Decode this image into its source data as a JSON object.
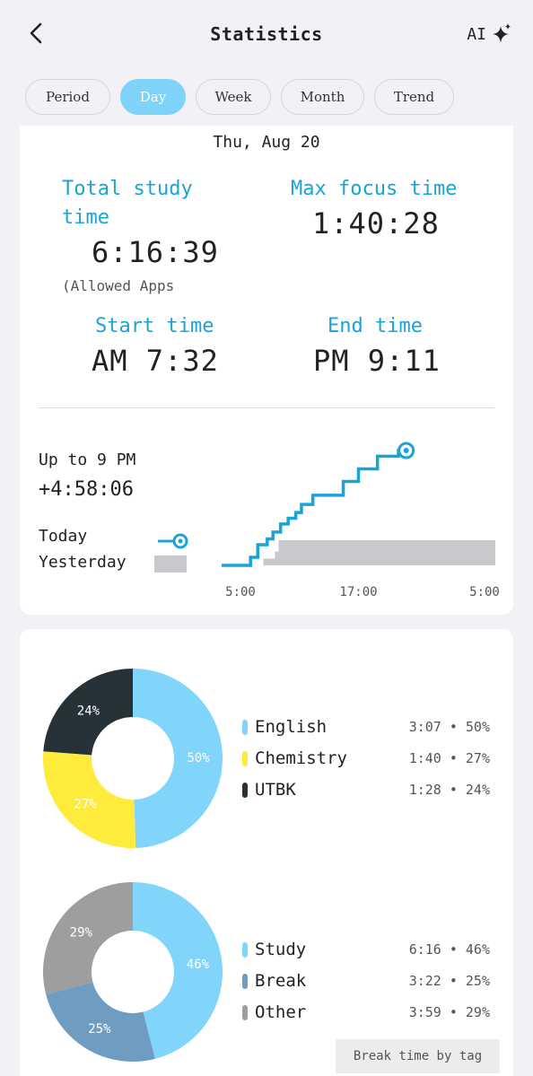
{
  "header": {
    "title": "Statistics",
    "ai_label": "AI"
  },
  "tabs": [
    {
      "label": "Period"
    },
    {
      "label": "Day",
      "active": true
    },
    {
      "label": "Week"
    },
    {
      "label": "Month"
    },
    {
      "label": "Trend"
    }
  ],
  "summary": {
    "date": "Thu, Aug 20",
    "total_label_line1": "Total study",
    "total_label_line2": "time",
    "total_value": "6:16:39",
    "total_note": "(Allowed Apps",
    "max_label": "Max focus time",
    "max_value": "1:40:28",
    "start_label": "Start time",
    "start_value": "AM 7:32",
    "end_label": "End time",
    "end_value": "PM 9:11"
  },
  "comparison": {
    "up_to_label": "Up to 9 PM",
    "delta": "+4:58:06",
    "today_label": "Today",
    "yesterday_label": "Yesterday",
    "x_ticks": [
      "5:00",
      "17:00",
      "5:00"
    ]
  },
  "chart_data": [
    {
      "type": "line",
      "title": "",
      "x_ticks": [
        "5:00",
        "17:00",
        "5:00"
      ],
      "series": [
        {
          "name": "Today",
          "color": "#1aa3d6",
          "x": [
            "5:00",
            "7:32",
            "8:10",
            "9:00",
            "9:30",
            "10:10",
            "10:50",
            "11:30",
            "12:00",
            "13:00",
            "15:40",
            "17:00",
            "18:40",
            "19:20",
            "20:30",
            "21:11"
          ],
          "y_fraction": [
            0.0,
            0.07,
            0.18,
            0.23,
            0.29,
            0.36,
            0.41,
            0.46,
            0.53,
            0.61,
            0.73,
            0.84,
            0.95,
            0.95,
            1.0,
            1.0
          ]
        },
        {
          "name": "Yesterday",
          "color": "#c9c9cd",
          "x": [
            "7:00",
            "8:40",
            "9:40",
            "10:00",
            "22:00",
            "5:00"
          ],
          "y_fraction": [
            0.0,
            0.06,
            0.12,
            0.22,
            0.22,
            0.22
          ]
        }
      ]
    },
    {
      "type": "pie",
      "title": "",
      "labels": [
        "English",
        "Chemistry",
        "UTBK"
      ],
      "values": [
        50,
        27,
        24
      ],
      "durations": [
        "3:07",
        "1:40",
        "1:28"
      ],
      "colors": [
        "#81d4fa",
        "#ffeb3b",
        "#263238"
      ]
    },
    {
      "type": "pie",
      "title": "",
      "labels": [
        "Study",
        "Break",
        "Other"
      ],
      "values": [
        46,
        25,
        29
      ],
      "durations": [
        "6:16",
        "3:22",
        "3:59"
      ],
      "colors": [
        "#81d4fa",
        "#6f9dc2",
        "#9e9e9e"
      ]
    }
  ],
  "subjects": [
    {
      "name": "English",
      "value": "3:07 • 50%",
      "pct_label": "50%",
      "color": "#81d4fa"
    },
    {
      "name": "Chemistry",
      "value": "1:40 • 27%",
      "pct_label": "27%",
      "color": "#ffeb3b"
    },
    {
      "name": "UTBK",
      "value": "1:28 • 24%",
      "pct_label": "24%",
      "color": "#263238"
    }
  ],
  "time_use": [
    {
      "name": "Study",
      "value": "6:16 • 46%",
      "pct_label": "46%",
      "color": "#81d4fa"
    },
    {
      "name": "Break",
      "value": "3:22 • 25%",
      "pct_label": "25%",
      "color": "#6f9dc2"
    },
    {
      "name": "Other",
      "value": "3:59 • 29%",
      "pct_label": "29%",
      "color": "#9e9e9e"
    }
  ],
  "break_button": "Break time by tag",
  "icons": {
    "back": "chevron-left-icon",
    "ai": "sparkle-icon"
  }
}
